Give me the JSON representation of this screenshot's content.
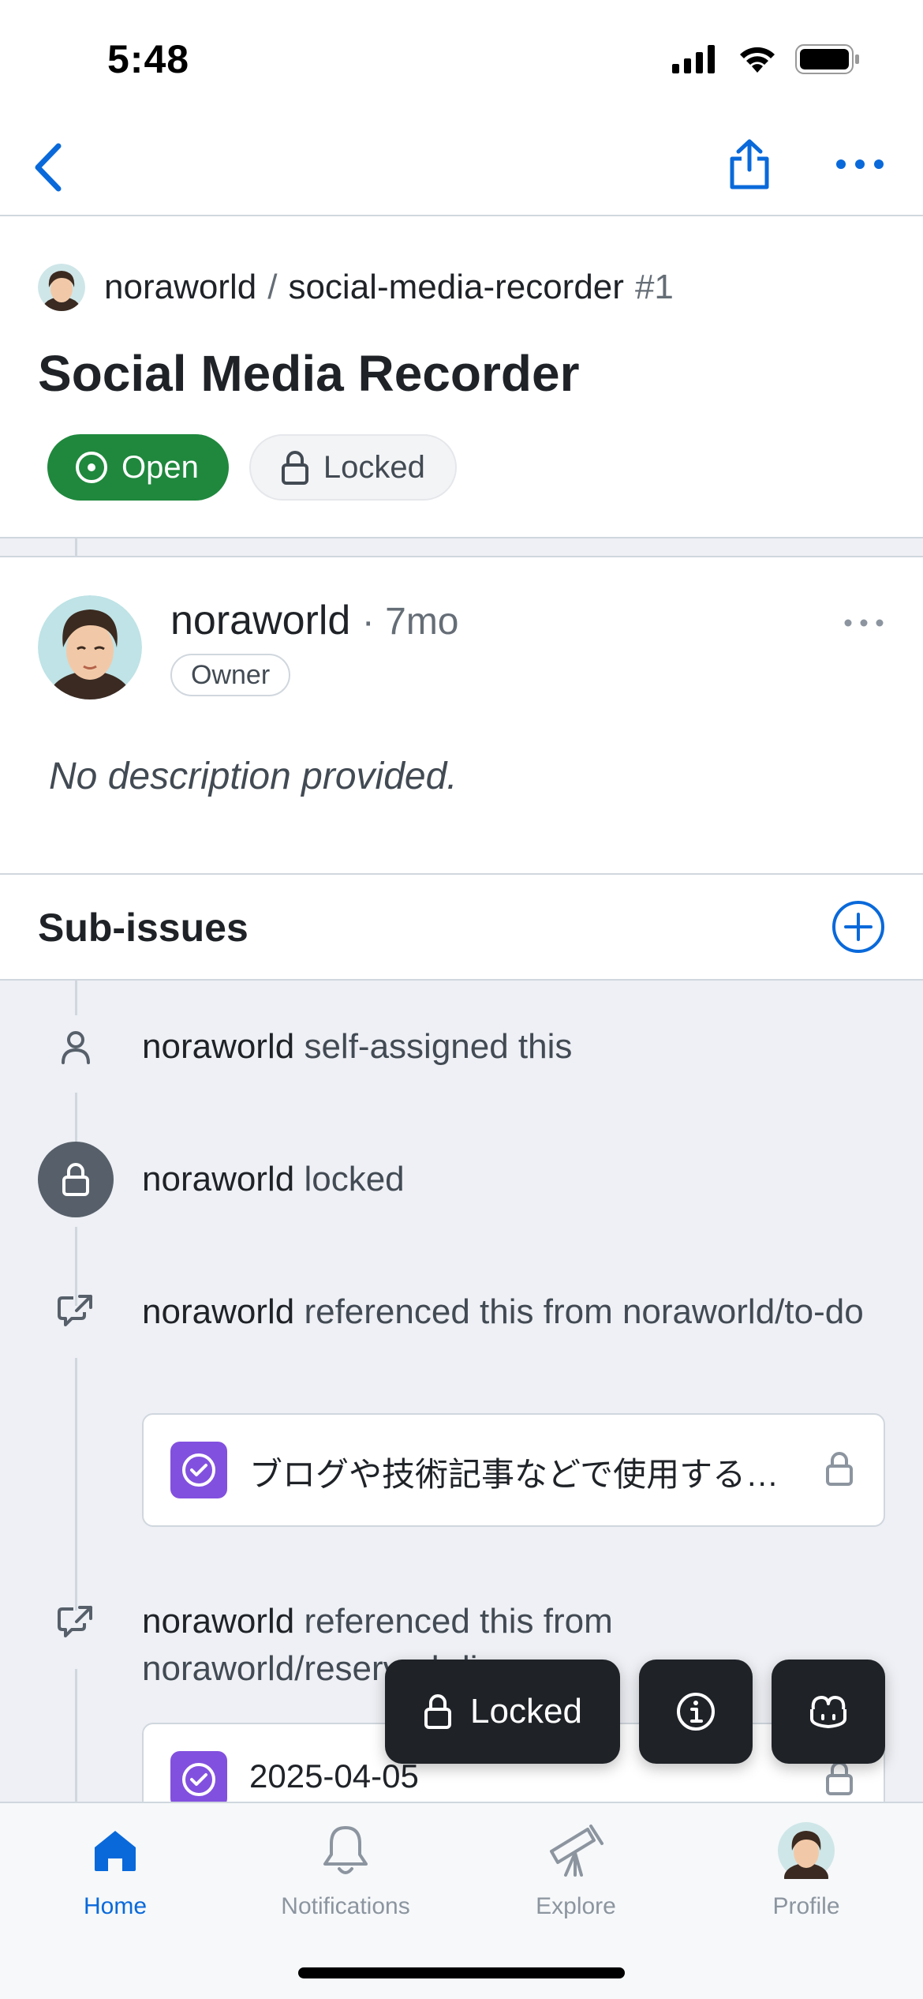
{
  "status_bar": {
    "time": "5:48"
  },
  "nav": {
    "back": "back-icon",
    "share": "share-icon",
    "more": "more-icon"
  },
  "issue": {
    "owner": "noraworld",
    "separator": "/",
    "repo": "social-media-recorder",
    "number": "#1",
    "title": "Social Media Recorder",
    "state_badge": "Open",
    "lock_badge": "Locked"
  },
  "comment": {
    "author": "noraworld",
    "time": "· 7mo",
    "role": "Owner",
    "body": "No description provided."
  },
  "sub_issues": {
    "title": "Sub-issues"
  },
  "timeline": [
    {
      "actor": "noraworld",
      "action": "self-assigned this",
      "icon": "person-icon"
    },
    {
      "actor": "noraworld",
      "action": "locked",
      "icon": "lock-icon"
    },
    {
      "actor": "noraworld",
      "action": "referenced this from noraworld/to-do",
      "icon": "cross-reference-icon",
      "ref_title": "ブログや技術記事などで使用する…"
    },
    {
      "actor": "noraworld",
      "action": "referenced this from noraworld/reserved-diary",
      "icon": "cross-reference-icon",
      "ref_title": "2025-04-05"
    }
  ],
  "actions": {
    "locked": "Locked"
  },
  "tabs": [
    {
      "label": "Home",
      "icon": "home-icon",
      "active": true
    },
    {
      "label": "Notifications",
      "icon": "bell-icon",
      "active": false
    },
    {
      "label": "Explore",
      "icon": "telescope-icon",
      "active": false
    },
    {
      "label": "Profile",
      "icon": "avatar",
      "active": false
    }
  ],
  "colors": {
    "accent": "#0969da",
    "open": "#1f883d",
    "closed_purple": "#8250df"
  }
}
